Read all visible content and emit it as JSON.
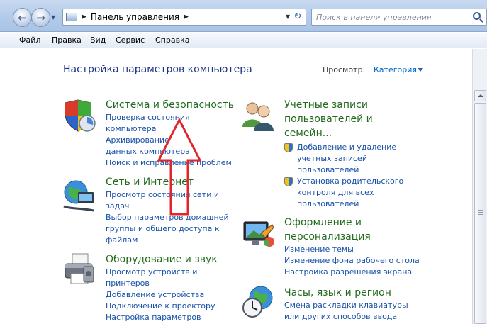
{
  "address": {
    "path": "Панель управления",
    "search_placeholder": "Поиск в панели управления"
  },
  "menu": [
    "Файл",
    "Правка",
    "Вид",
    "Сервис",
    "Справка"
  ],
  "page": {
    "title": "Настройка параметров компьютера",
    "view_label": "Просмотр:",
    "view_value": "Категория"
  },
  "categories": {
    "system": {
      "title": "Система и безопасность",
      "links": [
        "Проверка состояния компьютера",
        "Архивирование данных компьютера",
        "Поиск и исправление проблем"
      ]
    },
    "network": {
      "title": "Сеть и Интернет",
      "links": [
        "Просмотр состояния сети и задач",
        "Выбор параметров домашней группы и общего доступа к файлам"
      ]
    },
    "hardware": {
      "title": "Оборудование и звук",
      "links": [
        "Просмотр устройств и принтеров",
        "Добавление устройства",
        "Подключение к проектору",
        "Настройка параметров"
      ]
    },
    "users": {
      "title": "Учетные записи пользователей и семейн...",
      "links": [
        "Добавление и удаление учетных записей пользователей",
        "Установка родительского контроля для всех пользователей"
      ]
    },
    "appearance": {
      "title": "Оформление и персонализация",
      "links": [
        "Изменение темы",
        "Изменение фона рабочего стола",
        "Настройка разрешения экрана"
      ]
    },
    "clock": {
      "title": "Часы, язык и регион",
      "links": [
        "Смена раскладки клавиатуры или других способов ввода"
      ]
    }
  },
  "colors": {
    "category_title": "#226b1e",
    "link": "#1751a8",
    "annotation_arrow": "#e0262a"
  },
  "icons": [
    "back-arrow-icon",
    "forward-arrow-icon",
    "control-panel-icon",
    "refresh-icon",
    "search-icon",
    "system-security-shield-icon",
    "network-globe-icon",
    "printer-icon",
    "users-icon",
    "uac-shield-icon",
    "appearance-display-icon",
    "clock-globe-icon"
  ]
}
